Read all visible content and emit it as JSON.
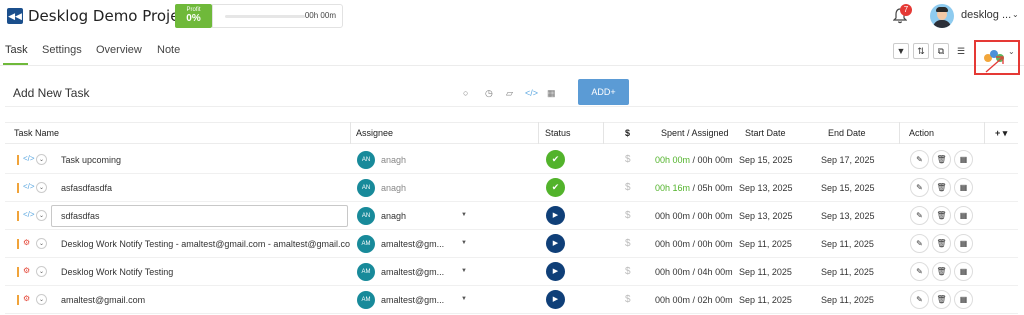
{
  "header": {
    "title": "Desklog Demo Project",
    "profit_label": "Profit",
    "profit_value": "0%",
    "progress_fraction": 0,
    "time": "00h 00m",
    "notif_count": "7",
    "user_name": "desklog ..."
  },
  "tabs": [
    "Task",
    "Settings",
    "Overview",
    "Note"
  ],
  "add_task": {
    "label": "Add New Task",
    "button": "ADD+"
  },
  "columns": {
    "task_name": "Task Name",
    "assignee": "Assignee",
    "status": "Status",
    "dollar": "$",
    "spent": "Spent / Assigned",
    "start": "Start Date",
    "end": "End Date",
    "action": "Action",
    "plus": "+"
  },
  "rows": [
    {
      "type": "code",
      "name": "Task upcoming",
      "initials": "AN",
      "assignee": "anagh",
      "status": "done",
      "spent": "00h 00m",
      "assigned": "00h 00m",
      "spent_green": true,
      "start": "Sep 15, 2025",
      "end": "Sep 17, 2025"
    },
    {
      "type": "code",
      "name": "asfasdfasdfa",
      "initials": "AN",
      "assignee": "anagh",
      "status": "done",
      "spent": "00h 16m",
      "assigned": "05h 00m",
      "spent_green": true,
      "start": "Sep 13, 2025",
      "end": "Sep 15, 2025"
    },
    {
      "type": "code",
      "name": "sdfasdfas",
      "initials": "AN",
      "assignee": "anagh",
      "status": "play",
      "spent": "00h 00m",
      "assigned": "00h 00m",
      "spent_green": false,
      "start": "Sep 13, 2025",
      "end": "Sep 13, 2025",
      "editing": true
    },
    {
      "type": "bug",
      "name": "Desklog Work Notify Testing - amaltest@gmail.com - amaltest@gmail.co",
      "initials": "AM",
      "assignee": "amaltest@gm...",
      "status": "play",
      "spent": "00h 00m",
      "assigned": "00h 00m",
      "spent_green": false,
      "start": "Sep 11, 2025",
      "end": "Sep 11, 2025"
    },
    {
      "type": "bug",
      "name": "Desklog Work Notify Testing",
      "initials": "AM",
      "assignee": "amaltest@gm...",
      "status": "play",
      "spent": "00h 00m",
      "assigned": "04h 00m",
      "spent_green": false,
      "start": "Sep 11, 2025",
      "end": "Sep 11, 2025"
    },
    {
      "type": "bug",
      "name": "amaltest@gmail.com",
      "initials": "AM",
      "assignee": "amaltest@gm...",
      "status": "play",
      "spent": "00h 00m",
      "assigned": "02h 00m",
      "spent_green": false,
      "start": "Sep 11, 2025",
      "end": "Sep 11, 2025"
    }
  ]
}
